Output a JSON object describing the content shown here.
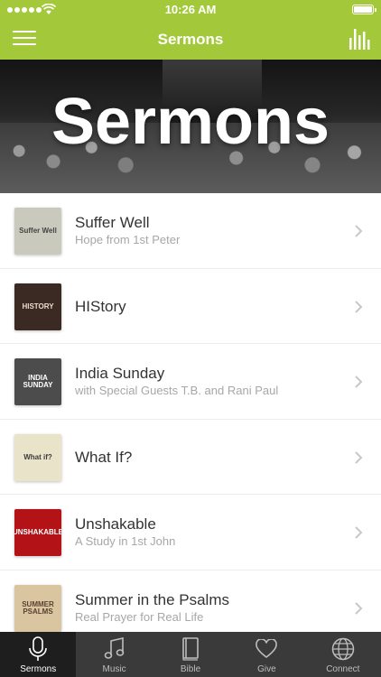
{
  "status_bar": {
    "time": "10:26 AM"
  },
  "nav": {
    "title": "Sermons"
  },
  "hero": {
    "title": "Sermons"
  },
  "sermons": [
    {
      "title": "Suffer Well",
      "subtitle": "Hope from 1st Peter",
      "art_text": "Suffer Well",
      "art_bg": "#c9c9bd",
      "art_fg": "#444444"
    },
    {
      "title": "HIStory",
      "subtitle": "",
      "art_text": "HISTORY",
      "art_bg": "#3b2a24",
      "art_fg": "#e9dccb"
    },
    {
      "title": "India Sunday",
      "subtitle": "with Special Guests T.B. and Rani Paul",
      "art_text": "INDIA SUNDAY",
      "art_bg": "#4c4c4c",
      "art_fg": "#ffffff"
    },
    {
      "title": "What If?",
      "subtitle": "",
      "art_text": "What if?",
      "art_bg": "#e8e3c9",
      "art_fg": "#3a3a3a"
    },
    {
      "title": "Unshakable",
      "subtitle": "A Study in 1st John",
      "art_text": "UNSHAKABLE",
      "art_bg": "#b31217",
      "art_fg": "#ffffff"
    },
    {
      "title": "Summer in the Psalms",
      "subtitle": "Real Prayer for Real Life",
      "art_text": "SUMMER PSALMS",
      "art_bg": "#d9c6a0",
      "art_fg": "#5a4030"
    }
  ],
  "tabs": [
    {
      "label": "Sermons",
      "icon": "microphone-icon",
      "active": true
    },
    {
      "label": "Music",
      "icon": "music-note-icon",
      "active": false
    },
    {
      "label": "Bible",
      "icon": "book-icon",
      "active": false
    },
    {
      "label": "Give",
      "icon": "heart-icon",
      "active": false
    },
    {
      "label": "Connect",
      "icon": "globe-icon",
      "active": false
    }
  ],
  "colors": {
    "accent": "#a3c93a",
    "tabbar": "#3a3a3a",
    "tab_active": "#1e1e1e"
  }
}
